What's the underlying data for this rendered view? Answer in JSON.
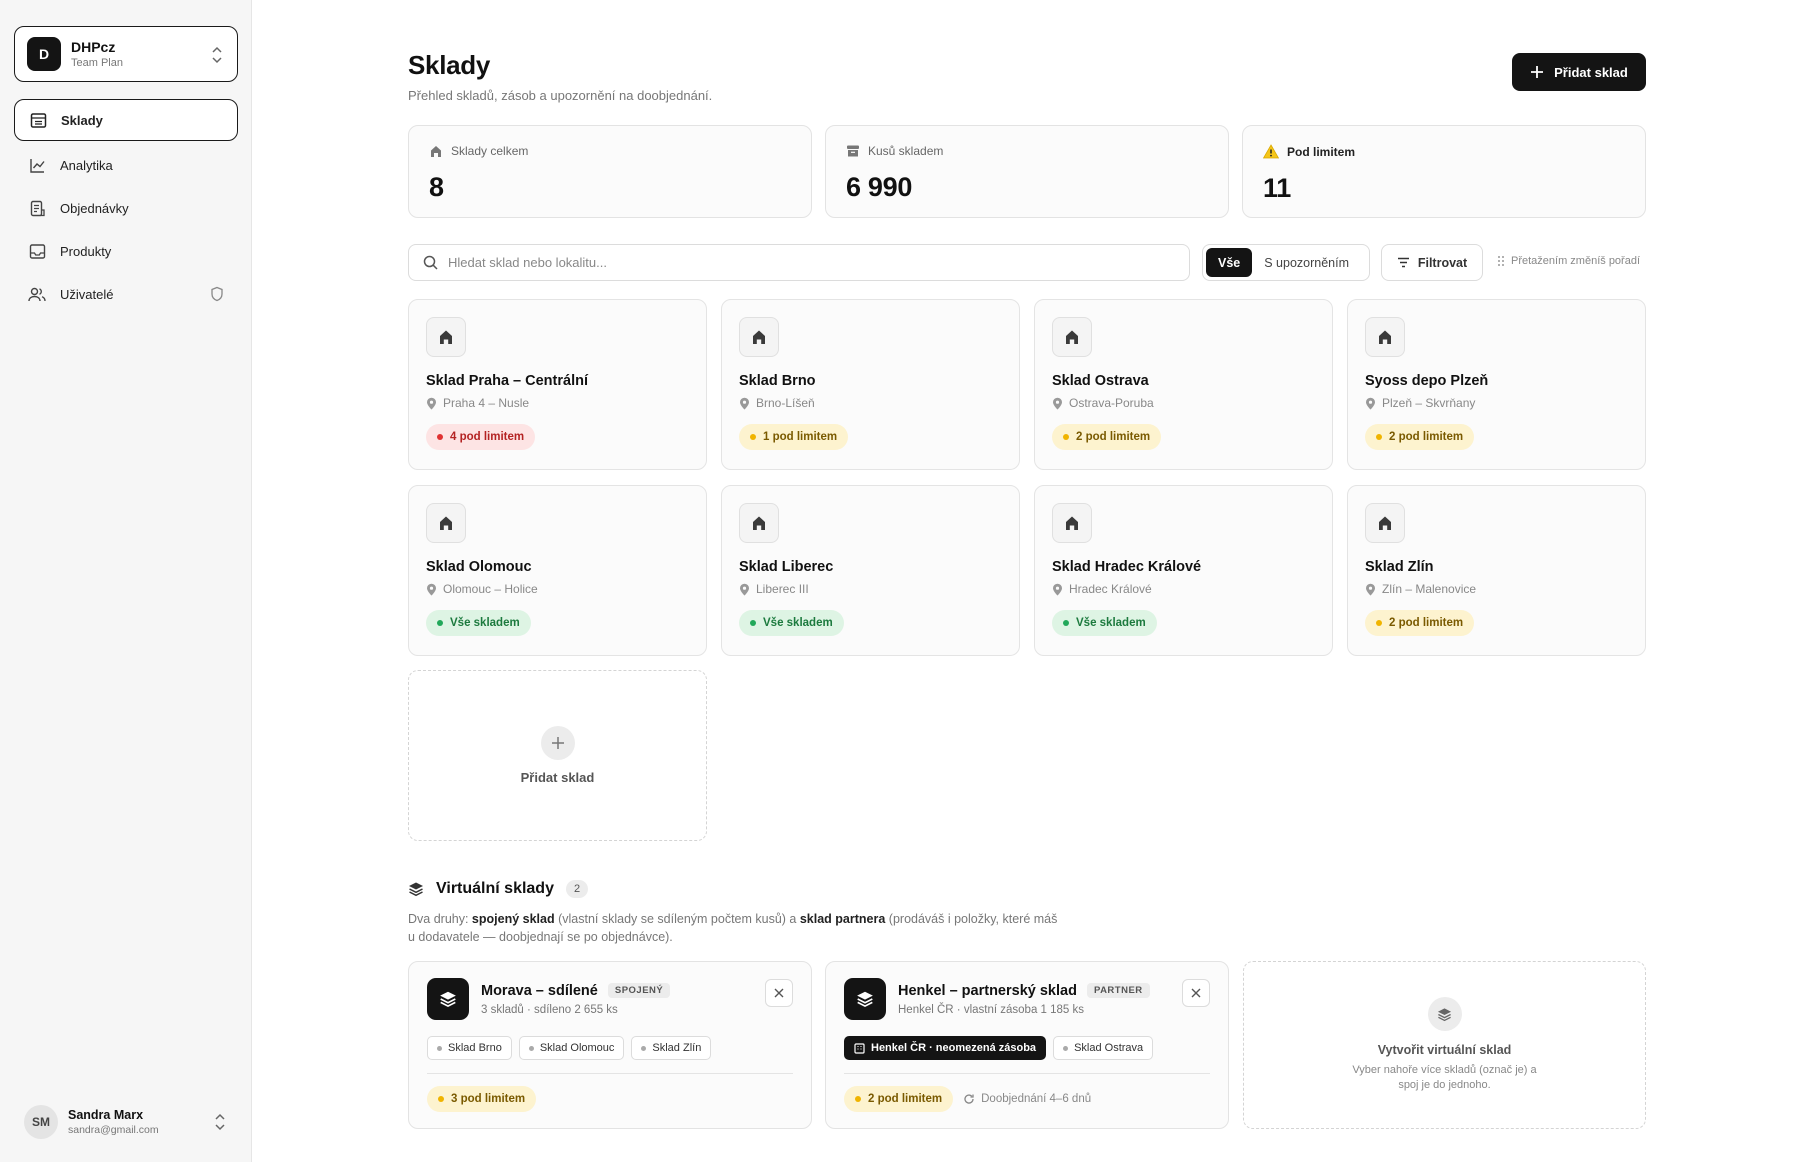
{
  "team": {
    "initial": "D",
    "name": "DHPcz",
    "plan": "Team Plan"
  },
  "nav": [
    {
      "label": "Sklady",
      "icon": "warehouse-icon",
      "active": true
    },
    {
      "label": "Analytika",
      "icon": "chart-line-icon"
    },
    {
      "label": "Objednávky",
      "icon": "orders-icon"
    },
    {
      "label": "Produkty",
      "icon": "inbox-icon"
    },
    {
      "label": "Uživatelé",
      "icon": "users-icon"
    }
  ],
  "user": {
    "initials": "SM",
    "name": "Sandra Marx",
    "email": "sandra@gmail.com"
  },
  "page": {
    "title": "Sklady",
    "subtitle": "Přehled skladů, zásob a upozornění na doobjednání.",
    "add_button": "Přidat sklad"
  },
  "stats": [
    {
      "label": "Sklady celkem",
      "value": "8"
    },
    {
      "label": "Kusů skladem",
      "value": "6 990"
    },
    {
      "label": "Pod limitem",
      "value": "11"
    }
  ],
  "toolbar": {
    "search_placeholder": "Hledat sklad nebo lokalitu...",
    "seg_all": "Vše",
    "seg_warn": "S upozorněním",
    "filter": "Filtrovat",
    "reorder_hint": "Přetažením změníš pořadí"
  },
  "warehouses": [
    {
      "name": "Sklad Praha – Centrální",
      "location": "Praha 4 – Nusle",
      "status": "4 pod limitem",
      "tone": "red"
    },
    {
      "name": "Sklad Brno",
      "location": "Brno-Líšeň",
      "status": "1 pod limitem",
      "tone": "yel"
    },
    {
      "name": "Sklad Ostrava",
      "location": "Ostrava-Poruba",
      "status": "2 pod limitem",
      "tone": "yel"
    },
    {
      "name": "Syoss depo Plzeň",
      "location": "Plzeň – Skvrňany",
      "status": "2 pod limitem",
      "tone": "yel"
    },
    {
      "name": "Sklad Olomouc",
      "location": "Olomouc – Holice",
      "status": "Vše skladem",
      "tone": "grn"
    },
    {
      "name": "Sklad Liberec",
      "location": "Liberec III",
      "status": "Vše skladem",
      "tone": "grn"
    },
    {
      "name": "Sklad Hradec Králové",
      "location": "Hradec Králové",
      "status": "Vše skladem",
      "tone": "grn"
    },
    {
      "name": "Sklad Zlín",
      "location": "Zlín – Malenovice",
      "status": "2 pod limitem",
      "tone": "yel"
    }
  ],
  "add_card": "Přidat sklad",
  "virtual": {
    "title": "Virtuální sklady",
    "count": "2",
    "desc_pre": "Dva druhy: ",
    "desc_b1": "spojený sklad",
    "desc_mid": " (vlastní sklady se sdíleným počtem kusů) a ",
    "desc_b2": "sklad partnera",
    "desc_post": " (prodáváš i položky, které máš u dodavatele — doobjednají se po objednávce).",
    "cards": [
      {
        "name": "Morava – sdílené",
        "tag": "SPOJENÝ",
        "sub": "3 skladů · sdíleno 2 655 ks",
        "chips": [
          "Sklad Brno",
          "Sklad Olomouc",
          "Sklad Zlín"
        ],
        "status": "3 pod limitem"
      },
      {
        "name": "Henkel – partnerský sklad",
        "tag": "PARTNER",
        "sub": "Henkel ČR · vlastní zásoba 1 185 ks",
        "chip_dark": "Henkel ČR · neomezená zásoba",
        "chips": [
          "Sklad Ostrava"
        ],
        "status": "2 pod limitem",
        "lead": "Doobjednání 4–6 dnů"
      }
    ],
    "create_title": "Vytvořit virtuální sklad",
    "create_desc": "Vyber nahoře více skladů (označ je) a spoj je do jednoho."
  }
}
